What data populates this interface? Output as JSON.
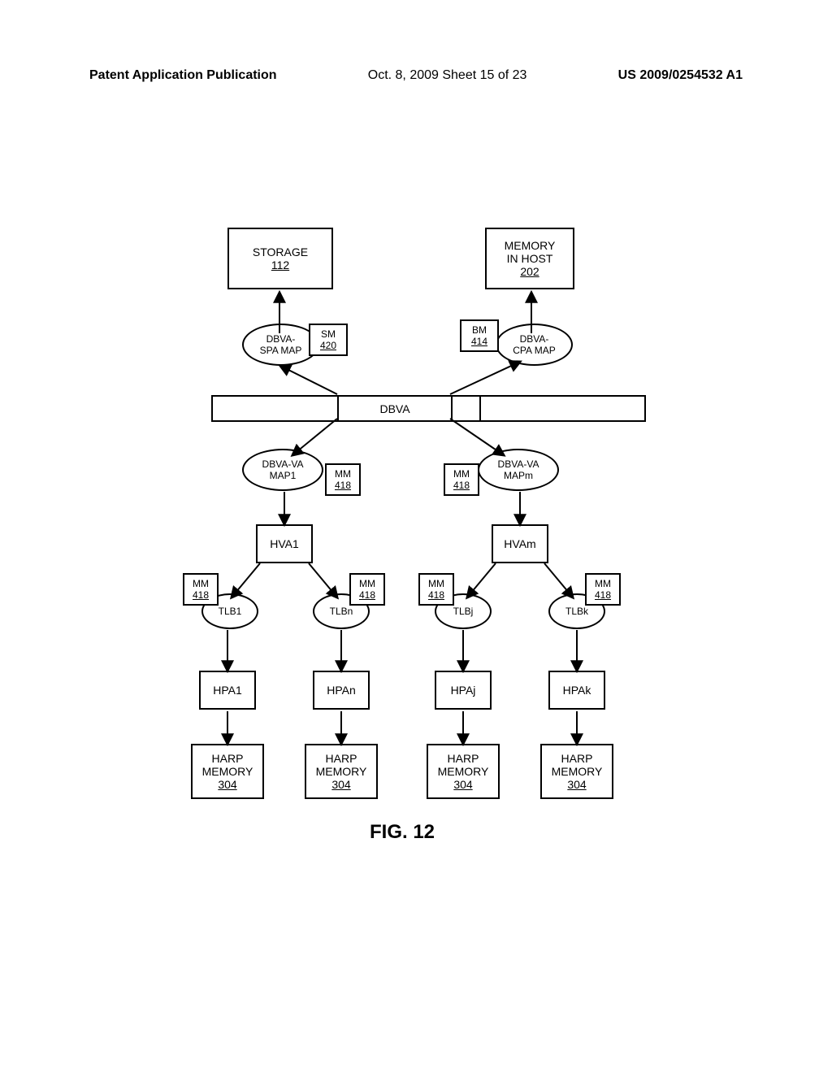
{
  "header": {
    "left": "Patent Application Publication",
    "center": "Oct. 8, 2009   Sheet 15 of 23",
    "right": "US 2009/0254532 A1"
  },
  "diagram": {
    "storage": {
      "label": "STORAGE",
      "ref": "112"
    },
    "memory_host": {
      "label1": "MEMORY",
      "label2": "IN HOST",
      "ref": "202"
    },
    "dbva_spa": {
      "label1": "DBVA-",
      "label2": "SPA MAP"
    },
    "dbva_cpa": {
      "label1": "DBVA-",
      "label2": "CPA MAP"
    },
    "sm": {
      "label": "SM",
      "ref": "420"
    },
    "bm": {
      "label": "BM",
      "ref": "414"
    },
    "dbva": "DBVA",
    "dbva_va_map1": {
      "label1": "DBVA-VA",
      "label2": "MAP1"
    },
    "dbva_va_mapm": {
      "label1": "DBVA-VA",
      "label2": "MAPm"
    },
    "mm": {
      "label": "MM",
      "ref": "418"
    },
    "hva1": "HVA1",
    "hvam": "HVAm",
    "tlb1": "TLB1",
    "tlbn": "TLBn",
    "tlbj": "TLBj",
    "tlbk": "TLBk",
    "hpa1": "HPA1",
    "hpan": "HPAn",
    "hpaj": "HPAj",
    "hpak": "HPAk",
    "harp": {
      "label1": "HARP",
      "label2": "MEMORY",
      "ref": "304"
    }
  },
  "figure": "FIG. 12"
}
